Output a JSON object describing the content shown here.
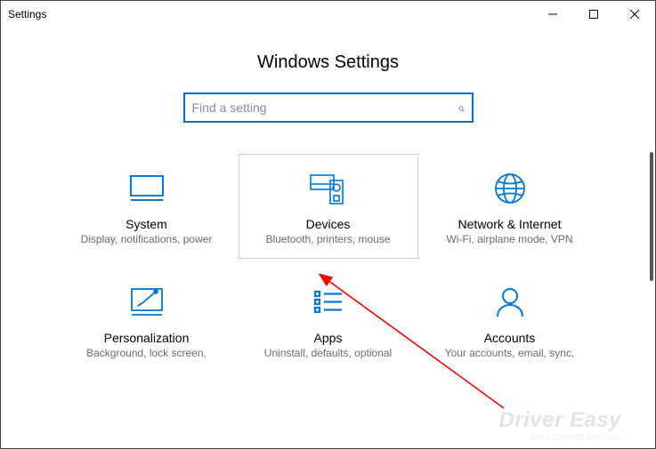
{
  "window": {
    "title": "Settings"
  },
  "page": {
    "heading": "Windows Settings"
  },
  "search": {
    "placeholder": "Find a setting"
  },
  "tiles": [
    {
      "title": "System",
      "desc": "Display, notifications, power"
    },
    {
      "title": "Devices",
      "desc": "Bluetooth, printers, mouse"
    },
    {
      "title": "Network & Internet",
      "desc": "Wi-Fi, airplane mode, VPN"
    },
    {
      "title": "Personalization",
      "desc": "Background, lock screen,"
    },
    {
      "title": "Apps",
      "desc": "Uninstall, defaults, optional"
    },
    {
      "title": "Accounts",
      "desc": "Your accounts, email, sync,"
    }
  ],
  "watermark": {
    "main": "Driver Easy",
    "sub": "www.DriverEasy.com"
  }
}
